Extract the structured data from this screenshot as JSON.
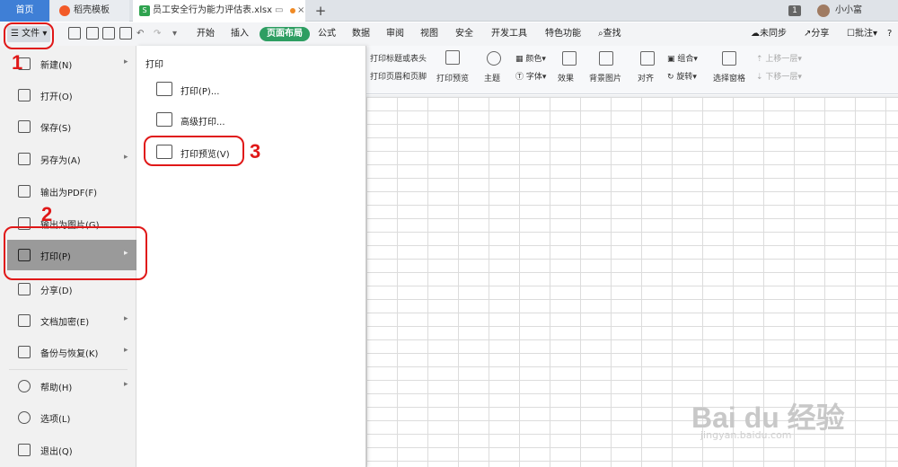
{
  "tabs": {
    "home": "首页",
    "template": "稻壳模板",
    "file": "员工安全行为能力评估表.xlsx",
    "add": "+"
  },
  "titlebar": {
    "badge": "1",
    "user": "小小富"
  },
  "menubar": {
    "file_label": "文件",
    "items": [
      "开始",
      "插入",
      "页面布局",
      "公式",
      "数据",
      "审阅",
      "视图",
      "安全",
      "开发工具",
      "特色功能"
    ],
    "active": "页面布局",
    "search": "查找",
    "sync": "未同步",
    "share": "分享",
    "comment": "批注"
  },
  "ribbon": {
    "print_title": "打印标题或表头",
    "print_header": "打印页眉和页脚",
    "print_preview": "打印预览",
    "theme": "主题",
    "color": "颜色",
    "font": "字体",
    "effect": "效果",
    "bg_image": "背景图片",
    "align": "对齐",
    "group": "组合",
    "rotate": "旋转",
    "selection_pane": "选择窗格",
    "up_layer": "上移一层",
    "down_layer": "下移一层"
  },
  "file_menu": {
    "items": [
      {
        "label": "新建(N)",
        "arrow": "▸"
      },
      {
        "label": "打开(O)"
      },
      {
        "label": "保存(S)"
      },
      {
        "label": "另存为(A)",
        "arrow": "▸"
      },
      {
        "label": "输出为PDF(F)"
      },
      {
        "label": "输出为图片(G)"
      },
      {
        "label": "打印(P)",
        "arrow": "▸"
      },
      {
        "label": "分享(D)"
      },
      {
        "label": "文档加密(E)",
        "arrow": "▸"
      },
      {
        "label": "备份与恢复(K)",
        "arrow": "▸"
      },
      {
        "label": "帮助(H)",
        "arrow": "▸"
      },
      {
        "label": "选项(L)"
      },
      {
        "label": "退出(Q)"
      }
    ]
  },
  "print_submenu": {
    "title": "打印",
    "items": [
      "打印(P)...",
      "高级打印...",
      "打印预览(V)"
    ]
  },
  "annotations": {
    "step1": "1",
    "step2": "2",
    "step3": "3",
    "color": "#e01818"
  },
  "watermark": {
    "main": "Bai du 经验",
    "sub": "jingyan.baidu.com"
  }
}
